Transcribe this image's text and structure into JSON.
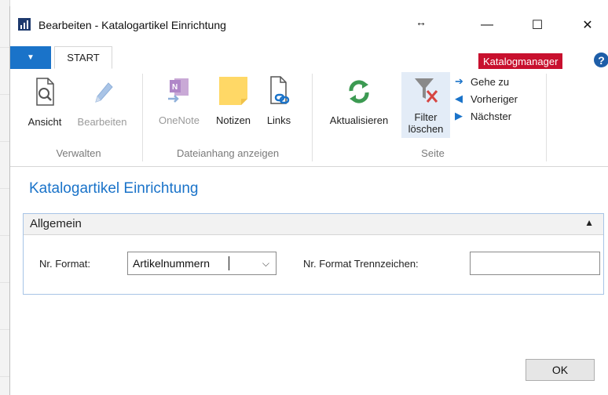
{
  "window": {
    "title": "Bearbeiten - Katalogartikel Einrichtung",
    "controls": {
      "minimize": "—",
      "maximize": "☐",
      "close": "✕"
    }
  },
  "ribbon_tabs": {
    "file_arrow": "▼",
    "start": "START",
    "katalogmanager": "Katalogmanager",
    "help": "?"
  },
  "ribbon": {
    "groups": {
      "verwalten": {
        "label": "Verwalten",
        "ansicht": "Ansicht",
        "bearbeiten": "Bearbeiten"
      },
      "dateianhang": {
        "label": "Dateianhang anzeigen",
        "onenote": "OneNote",
        "notizen": "Notizen",
        "links": "Links"
      },
      "seite": {
        "label": "Seite",
        "aktualisieren": "Aktualisieren",
        "filter_line1": "Filter",
        "filter_line2": "löschen",
        "gehe_zu": "Gehe zu",
        "vorheriger": "Vorheriger",
        "naechster": "Nächster"
      }
    }
  },
  "page": {
    "title": "Katalogartikel Einrichtung",
    "fasttab": {
      "title": "Allgemein",
      "nr_format_label": "Nr. Format:",
      "nr_format_value": "Artikelnummern",
      "trennzeichen_label": "Nr. Format Trennzeichen:",
      "trennzeichen_value": ""
    }
  },
  "footer": {
    "ok": "OK"
  },
  "colors": {
    "accent": "#1a73c9",
    "katalog_red": "#c8102e"
  }
}
